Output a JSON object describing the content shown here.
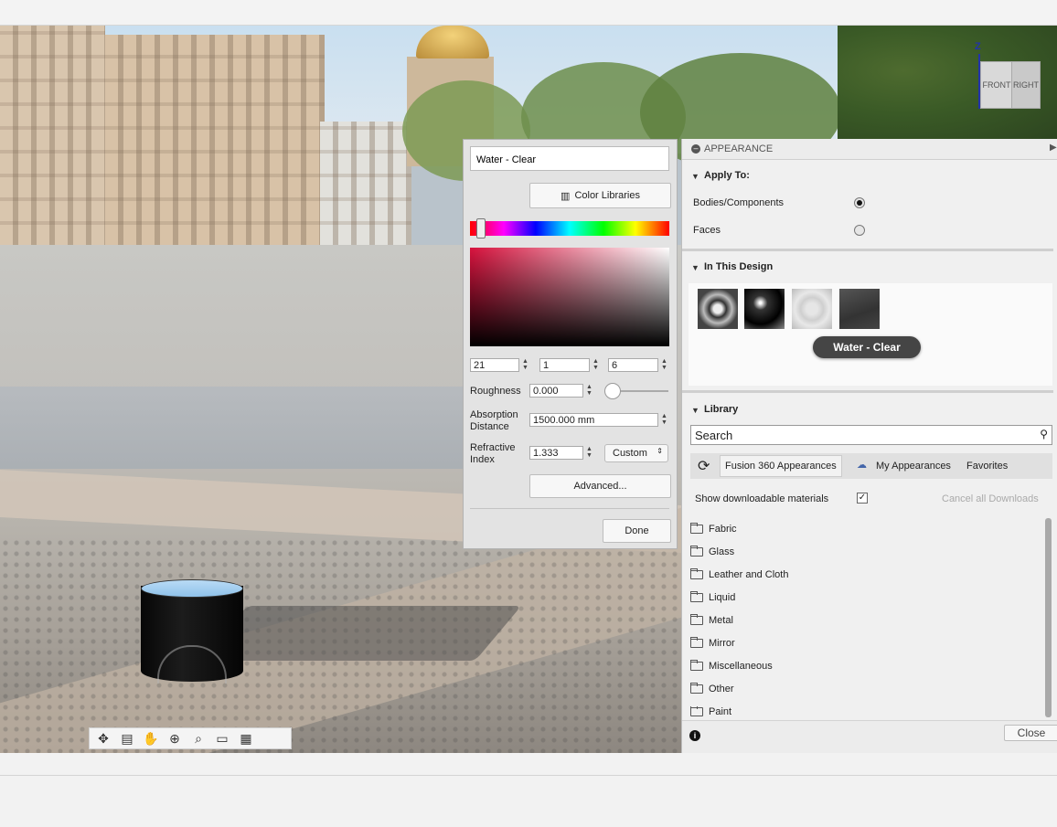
{
  "viewcube": {
    "axis_label": "Z",
    "front": "FRONT",
    "right": "RIGHT"
  },
  "navbar": {
    "icons": [
      "orbit-icon",
      "look-at-icon",
      "pan-icon",
      "zoom-icon",
      "fit-icon",
      "display-settings-icon",
      "grid-icon"
    ]
  },
  "color_editor": {
    "name_value": "Water - Clear",
    "color_libraries_label": "Color Libraries",
    "rgb": [
      "21",
      "1",
      "6"
    ],
    "roughness_label": "Roughness",
    "roughness_value": "0.000",
    "roughness_level": 0.0,
    "absorption_label": "Absorption Distance",
    "absorption_value": "1500.000 mm",
    "refractive_label": "Refractive Index",
    "refractive_value": "1.333",
    "refractive_preset": "Custom",
    "advanced_label": "Advanced...",
    "done_label": "Done",
    "accent": "#d6123d"
  },
  "panel": {
    "title": "APPEARANCE",
    "apply_to": {
      "heading": "Apply To:",
      "options": [
        {
          "label": "Bodies/Components",
          "selected": true
        },
        {
          "label": "Faces",
          "selected": false
        }
      ]
    },
    "in_this_design": {
      "heading": "In This Design",
      "tooltip": "Water - Clear"
    },
    "library": {
      "heading": "Library",
      "search_placeholder": "Search",
      "tabs": [
        "Fusion 360 Appearances",
        "My Appearances",
        "Favorites"
      ],
      "show_downloadable": "Show downloadable materials",
      "cancel_downloads": "Cancel all Downloads",
      "items": [
        "Fabric",
        "Glass",
        "Leather and Cloth",
        "Liquid",
        "Metal",
        "Mirror",
        "Miscellaneous",
        "Other",
        "Paint"
      ]
    },
    "close_label": "Close"
  }
}
